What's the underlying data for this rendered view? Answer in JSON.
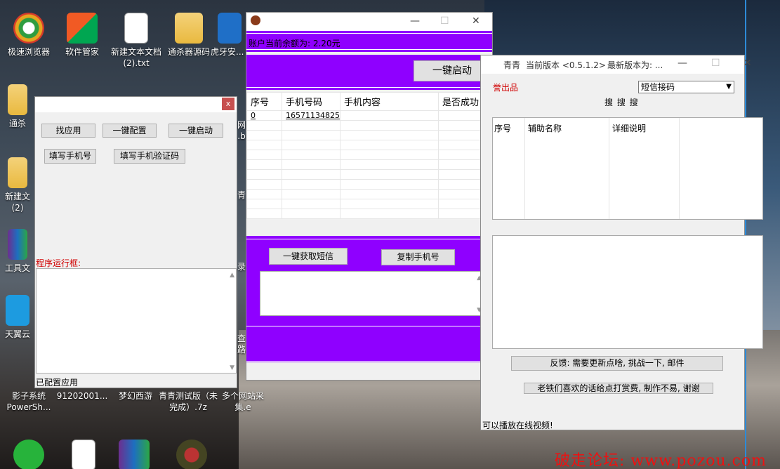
{
  "desktop": {
    "icons": [
      {
        "label": "极速浏览器"
      },
      {
        "label": "软件管家"
      },
      {
        "label": "新建文本文档 (2).txt"
      },
      {
        "label": "通杀器源码"
      },
      {
        "label": "虎牙安... 气..."
      },
      {
        "label": "通杀"
      },
      {
        "label": "新建文 (2)"
      },
      {
        "label": "工具文"
      },
      {
        "label": "天翼云"
      },
      {
        "label": "影子系统 PowerSh..."
      },
      {
        "label": "91202001..."
      },
      {
        "label": "梦幻西游"
      },
      {
        "label": "青青测试版（未完成）.7z"
      },
      {
        "label": "多个网站采集.e"
      }
    ],
    "partial_labels": {
      "a": "网",
      "b": ".b",
      "c": "青",
      "d": "录",
      "e": "查",
      "f": "路"
    },
    "watermark": "破走论坛: www.pozou.com"
  },
  "window_left": {
    "close_label": "x",
    "buttons": {
      "find_app": "找应用",
      "one_key_config": "一键配置",
      "one_key_start": "一键启动",
      "fill_phone": "填写手机号",
      "fill_code": "填写手机验证码"
    },
    "run_box_label": "程序运行框:",
    "status": "已配置应用"
  },
  "window_purple": {
    "balance": "账户当前余额为: 2.20元",
    "start_button": "一键启动",
    "table": {
      "headers": [
        "序号",
        "手机号码",
        "手机内容",
        "是否成功"
      ],
      "rows": [
        [
          "0",
          "16571134825",
          "",
          ""
        ]
      ]
    },
    "get_sms_button": "一键获取短信",
    "copy_phone_button": "复制手机号"
  },
  "window_right": {
    "title_app": "青青",
    "title_version": "当前版本 <0.5.1.2>",
    "title_latest": "最新版本为: ...",
    "brand_partial": "誉出品",
    "select_value": "短信接码",
    "search_label": "搜 搜 搜",
    "grid_headers": [
      "序号",
      "辅助名称",
      "详细说明"
    ],
    "feedback_button": "反馈: 需要更新点啥, 挑战一下, 邮件",
    "donate_button": "老铁们喜欢的话给点打赏费, 制作不易, 谢谢",
    "status": "可以播放在线视频!"
  }
}
